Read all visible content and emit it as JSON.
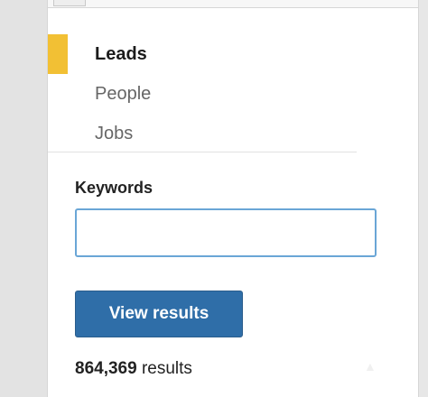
{
  "nav": {
    "items": [
      {
        "label": "Leads",
        "active": true
      },
      {
        "label": "People",
        "active": false
      },
      {
        "label": "Jobs",
        "active": false
      }
    ],
    "accent_color": "#f2c034"
  },
  "form": {
    "keywords_label": "Keywords",
    "keywords_value": "",
    "keywords_placeholder": ""
  },
  "actions": {
    "view_results_label": "View results",
    "button_color": "#2f6ea8"
  },
  "results": {
    "count": "864,369",
    "suffix": "results"
  }
}
